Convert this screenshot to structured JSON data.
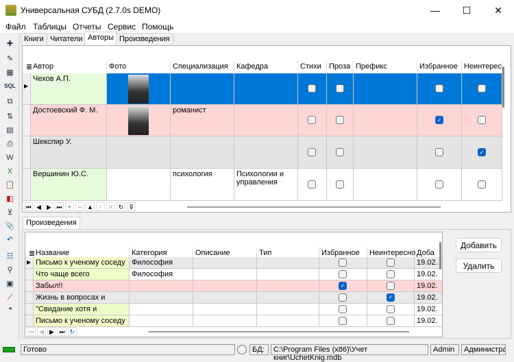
{
  "window": {
    "title": "Универсальная СУБД (2.7.0s DEMO)",
    "minimize": "—",
    "maximize": "☐",
    "close": "✕"
  },
  "menu": [
    "Файл",
    "Таблицы",
    "Отчеты",
    "Сервис",
    "Помощь"
  ],
  "tabs": [
    "Книги",
    "Читатели",
    "Авторы",
    "Произведения"
  ],
  "authors": {
    "columns": [
      "Автор",
      "Фото",
      "Специализация",
      "Кафедра",
      "Стихи",
      "Проза",
      "Префикс",
      "Избранное",
      "Неинтерес"
    ],
    "rows": [
      {
        "author": "Чехов А.П.",
        "photo": true,
        "spec": "",
        "dept": "",
        "poems": false,
        "prose": false,
        "prefix": "",
        "fav": false,
        "unint": false,
        "style": "selected"
      },
      {
        "author": "Достоевский Ф. М.",
        "photo": true,
        "spec": "романист",
        "dept": "",
        "poems": false,
        "prose": false,
        "prefix": "",
        "fav": true,
        "unint": false,
        "style": "pink"
      },
      {
        "author": "Шекспир У.",
        "photo": false,
        "spec": "",
        "dept": "",
        "poems": false,
        "prose": false,
        "prefix": "",
        "fav": false,
        "unint": true,
        "style": "gray"
      },
      {
        "author": "Вершинин Ю.С.",
        "photo": false,
        "spec": "психология",
        "dept": "Психологии и управления",
        "poems": false,
        "prose": false,
        "prefix": "",
        "fav": false,
        "unint": false,
        "style": "white"
      }
    ]
  },
  "works_tab": "Произведения",
  "works": {
    "columns": [
      "Название",
      "Категория",
      "Описание",
      "Тип",
      "Избранное",
      "Неинтересно",
      "Доба"
    ],
    "rows": [
      {
        "name": "Письмо к ученому соседу",
        "cat": "Философия",
        "fav": false,
        "unint": false,
        "date": "19.02.",
        "style": "gray"
      },
      {
        "name": "Что чаще всего",
        "cat": "Философия",
        "fav": false,
        "unint": false,
        "date": "19.02.",
        "style": "white"
      },
      {
        "name": "Забыл!!",
        "cat": "",
        "fav": true,
        "unint": false,
        "date": "19.02.",
        "style": "pink"
      },
      {
        "name": "Жизнь в вопросах и",
        "cat": "",
        "fav": false,
        "unint": true,
        "date": "19.02.",
        "style": "gray"
      },
      {
        "name": "\"Свидание хотя и",
        "cat": "",
        "fav": false,
        "unint": false,
        "date": "19.02.",
        "style": "white"
      },
      {
        "name": "Письмо к ученому соседу",
        "cat": "",
        "fav": false,
        "unint": false,
        "date": "19.02.",
        "style": "white"
      }
    ]
  },
  "buttons": {
    "add": "Добавить",
    "delete": "Удалить"
  },
  "status": {
    "ready": "Готово",
    "db_label": "БД:",
    "db_path": "C:\\Program Files (x86)\\Учет книг\\UchetKnig.mdb",
    "user": "Admin",
    "role": "Администра"
  }
}
